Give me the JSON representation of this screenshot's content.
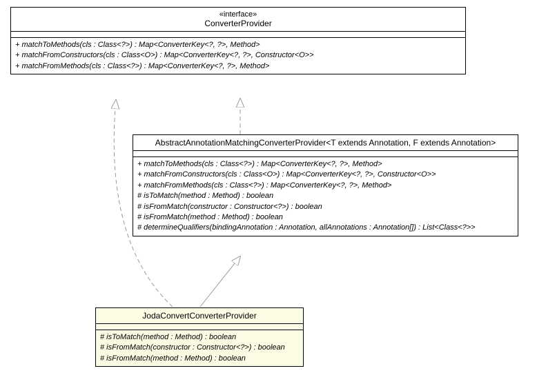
{
  "interface": {
    "stereotype": "«interface»",
    "name": "ConverterProvider",
    "methods": [
      "+ matchToMethods(cls : Class<?>) : Map<ConverterKey<?, ?>, Method>",
      "+ matchFromConstructors(cls : Class<O>) : Map<ConverterKey<?, ?>, Constructor<O>>",
      "+ matchFromMethods(cls : Class<?>) : Map<ConverterKey<?, ?>, Method>"
    ]
  },
  "abstract": {
    "name": "AbstractAnnotationMatchingConverterProvider<T extends Annotation, F extends Annotation>",
    "methods": [
      "+ matchToMethods(cls : Class<?>) : Map<ConverterKey<?, ?>, Method>",
      "+ matchFromConstructors(cls : Class<O>) : Map<ConverterKey<?, ?>, Constructor<O>>",
      "+ matchFromMethods(cls : Class<?>) : Map<ConverterKey<?, ?>, Method>",
      "# isToMatch(method : Method) : boolean",
      "# isFromMatch(constructor : Constructor<?>) : boolean",
      "# isFromMatch(method : Method) : boolean",
      "# determineQualifiers(bindingAnnotation : Annotation, allAnnotations : Annotation[]) : List<Class<?>>"
    ]
  },
  "concrete": {
    "name": "JodaConvertConverterProvider",
    "methods": [
      "# isToMatch(method : Method) : boolean",
      "# isFromMatch(constructor : Constructor<?>) : boolean",
      "# isFromMatch(method : Method) : boolean"
    ]
  }
}
